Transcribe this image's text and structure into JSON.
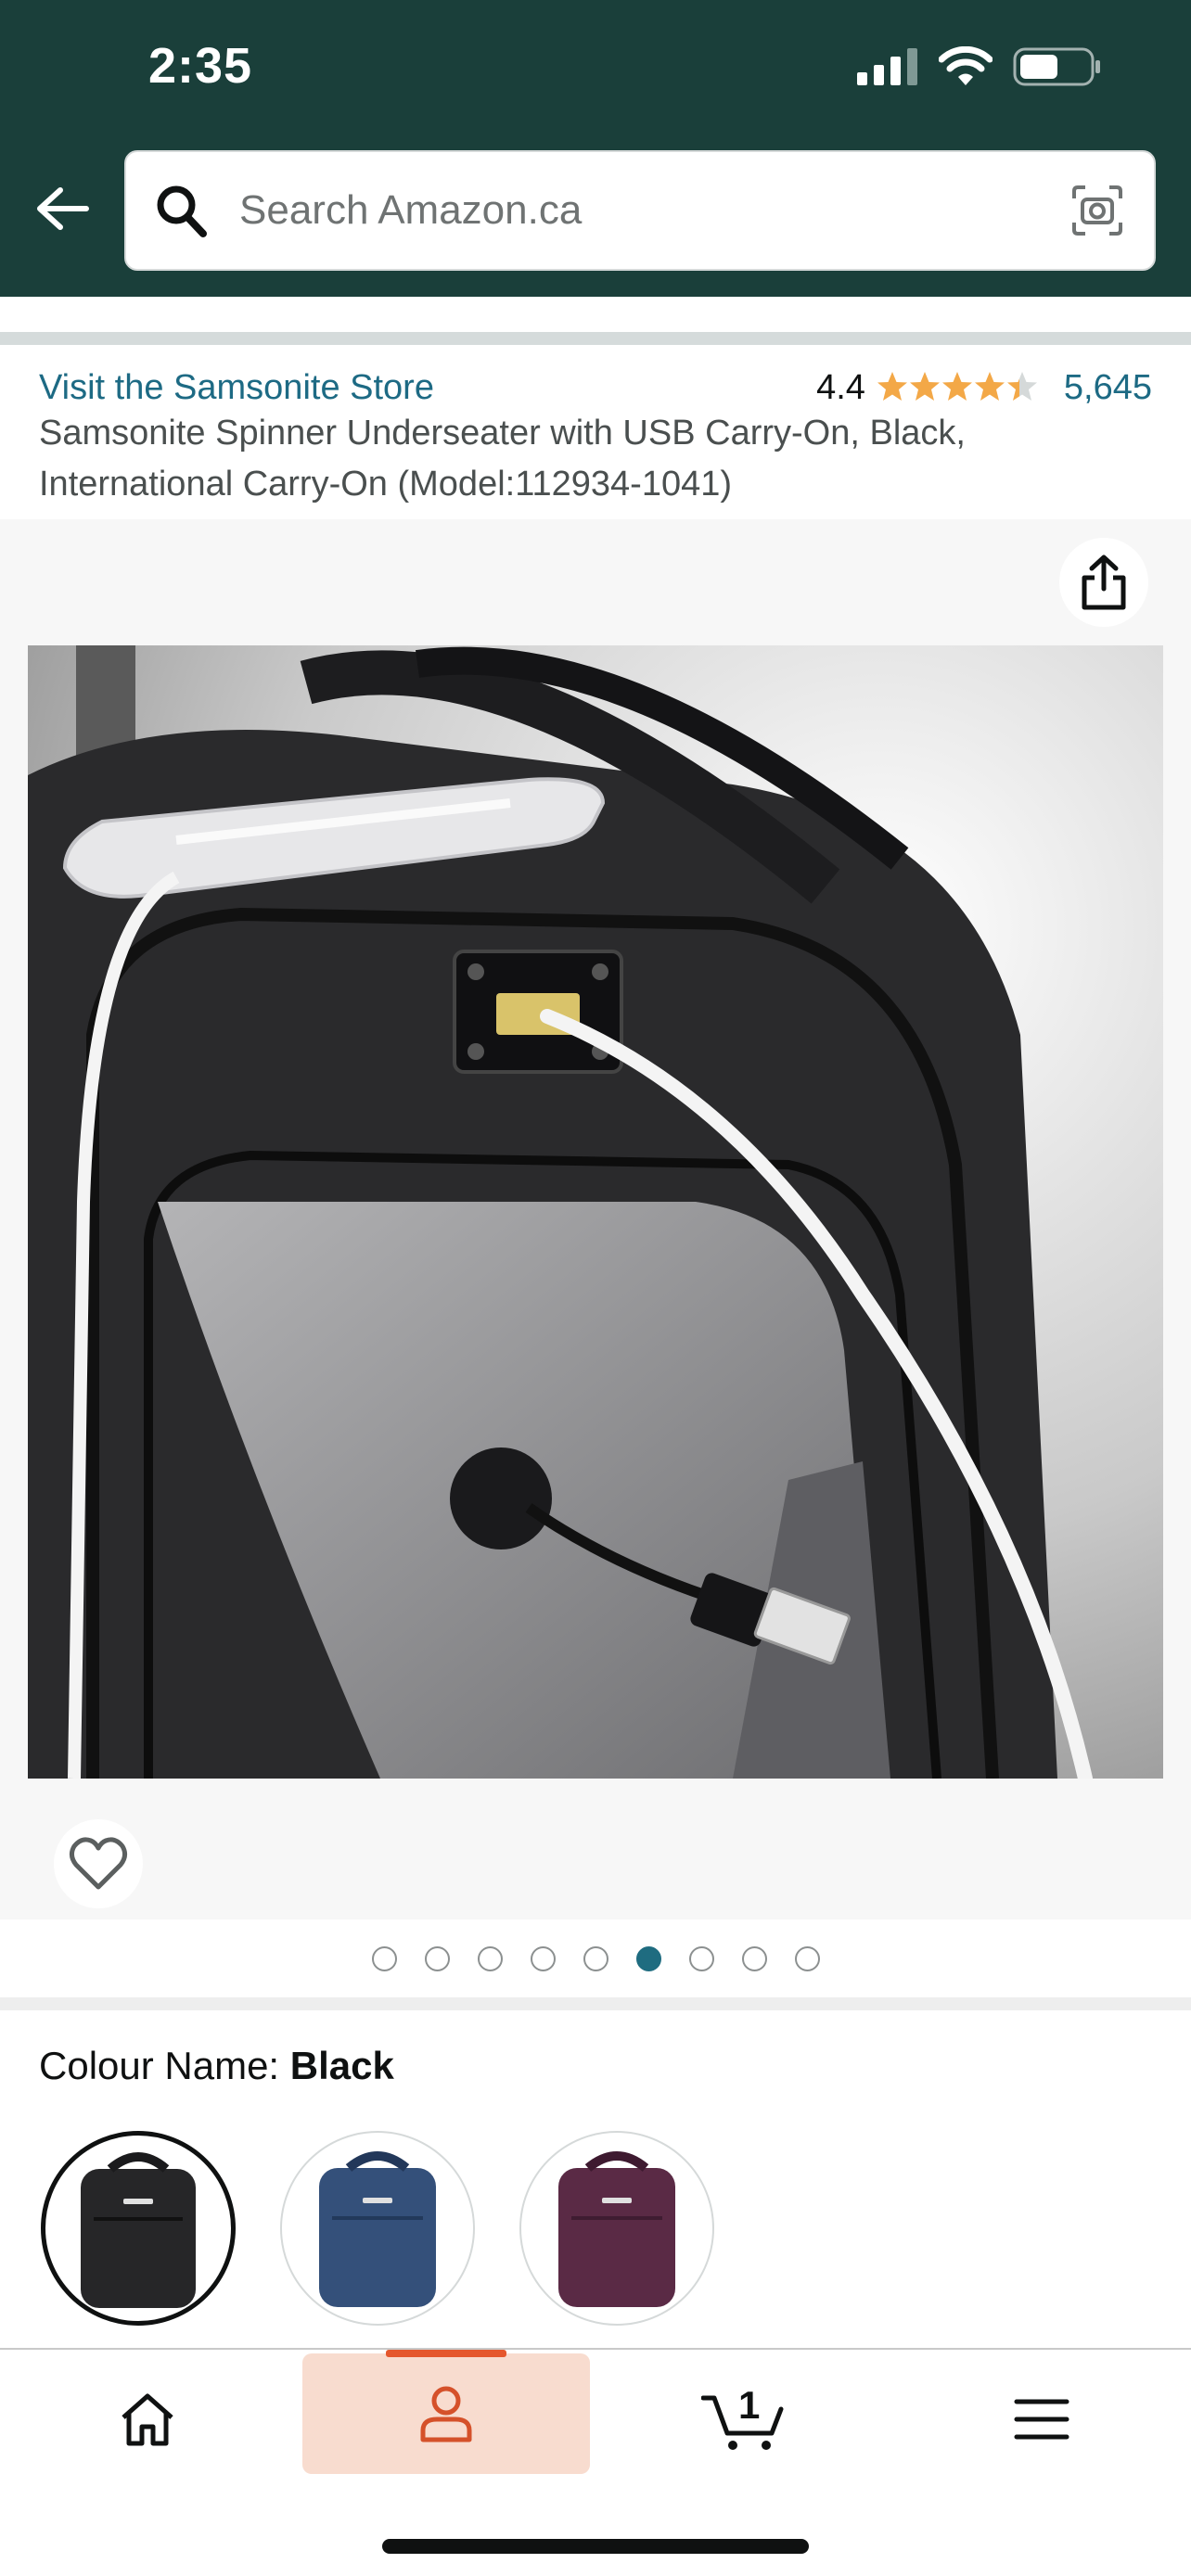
{
  "status_bar": {
    "time": "2:35"
  },
  "search": {
    "placeholder": "Search Amazon.ca"
  },
  "product": {
    "store_link": "Visit the Samsonite Store",
    "rating": "4.4",
    "rating_value": 4.4,
    "review_count": "5,645",
    "title": "Samsonite Spinner Underseater with USB Carry-On, Black, International Carry-On (Model:112934-1041)"
  },
  "gallery": {
    "image_count": 9,
    "active_index": 5
  },
  "colour": {
    "label": "Colour Name:",
    "selected": "Black",
    "options": [
      {
        "name": "Black",
        "color": "#2a2a2a"
      },
      {
        "name": "Blue",
        "color": "#34507a"
      },
      {
        "name": "Purple",
        "color": "#5a2a45"
      }
    ]
  },
  "nav": {
    "cart_count": "1"
  },
  "colors": {
    "header_bg": "#1a3f3a",
    "link": "#1d6a84",
    "star": "#f3a847",
    "accent": "#e5572d"
  }
}
